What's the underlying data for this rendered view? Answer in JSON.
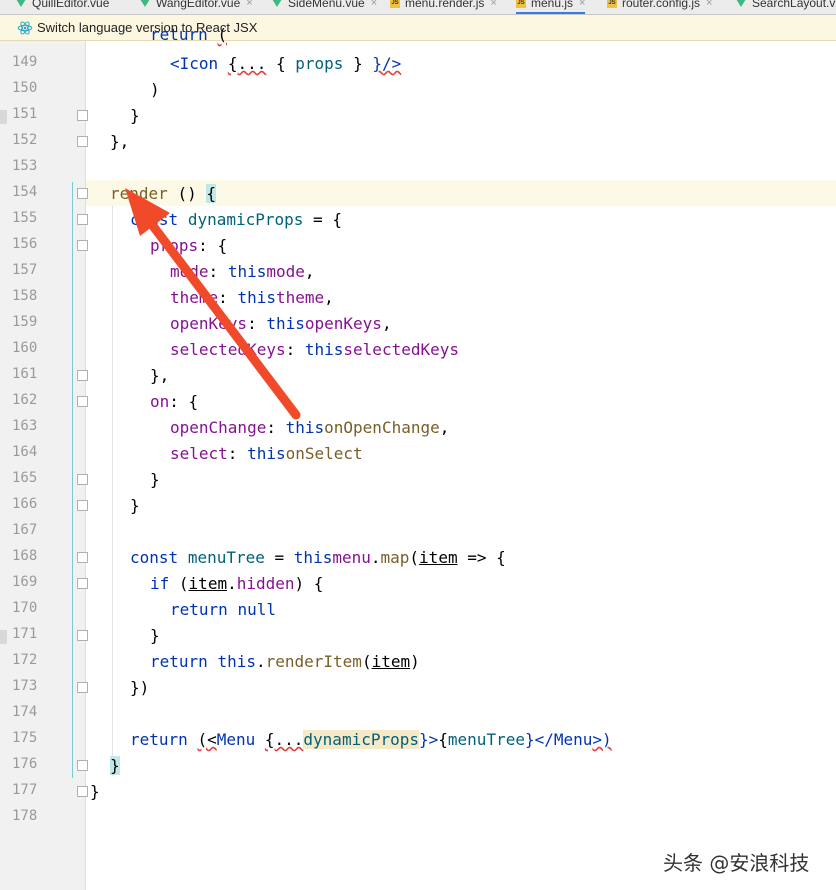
{
  "tabs": [
    {
      "label": "QuillEditor.vue",
      "type": "vue"
    },
    {
      "label": "WangEditor.vue",
      "type": "vue"
    },
    {
      "label": "SideMenu.vue",
      "type": "vue"
    },
    {
      "label": "menu.render.js",
      "type": "js"
    },
    {
      "label": "menu.js",
      "type": "js",
      "active": true
    },
    {
      "label": "router.config.js",
      "type": "js"
    },
    {
      "label": "SearchLayout.vue",
      "type": "vue"
    }
  ],
  "banner": {
    "text": "Switch language version to React JSX"
  },
  "line_numbers": [
    "149",
    "150",
    "151",
    "152",
    "153",
    "154",
    "155",
    "156",
    "157",
    "158",
    "159",
    "160",
    "161",
    "162",
    "163",
    "164",
    "165",
    "166",
    "167",
    "168",
    "169",
    "170",
    "171",
    "172",
    "173",
    "174",
    "175",
    "176",
    "177",
    "178"
  ],
  "code": {
    "l148": {
      "a": "return",
      "b": "(",
      "top_partial": true
    },
    "l149": {
      "a": "<Icon",
      "b": "{...",
      "c": "{",
      "d": "props",
      "e": "}",
      "f": "}/>"
    },
    "l150": {
      "a": ")"
    },
    "l151": {
      "a": "}"
    },
    "l152": {
      "a": "},"
    },
    "l154": {
      "a": "render",
      "b": "()",
      "c": "{"
    },
    "l155": {
      "a": "const",
      "b": "dynamicProps",
      "c": "= {"
    },
    "l156": {
      "a": "props",
      ":": ": {"
    },
    "l157": {
      "a": "mode",
      "b": ":",
      "c": "this",
      ".": ".",
      "d": "mode",
      ",": ","
    },
    "l158": {
      "a": "theme",
      "b": ":",
      "c": "this",
      ".": ".",
      "d": "theme",
      ",": ","
    },
    "l159": {
      "a": "openKeys",
      "b": ":",
      "c": "this",
      ".": ".",
      "d": "openKeys",
      ",": ","
    },
    "l160": {
      "a": "selectedKeys",
      "b": ":",
      "c": "this",
      ".": ".",
      "d": "selectedKeys"
    },
    "l161": {
      "a": "},"
    },
    "l162": {
      "a": "on",
      "b": ": {"
    },
    "l163": {
      "a": "openChange",
      "b": ":",
      "c": "this",
      ".": ".",
      "d": "onOpenChange",
      ",": ","
    },
    "l164": {
      "a": "select",
      "b": ":",
      "c": "this",
      ".": ".",
      "d": "onSelect"
    },
    "l165": {
      "a": "}"
    },
    "l166": {
      "a": "}"
    },
    "l168": {
      "a": "const",
      "b": "menuTree",
      "c": "=",
      "d": "this",
      ".": ".",
      "e": "menu",
      "f": ".",
      "g": "map",
      "h": "(",
      "i": "item",
      "j": "=> {"
    },
    "l169": {
      "a": "if",
      "b": "(",
      "c": "item",
      "d": ".",
      "e": "hidden",
      "f": ") {"
    },
    "l170": {
      "a": "return",
      "b": "null"
    },
    "l171": {
      "a": "}"
    },
    "l172": {
      "a": "return",
      "b": "this",
      "c": ".",
      "d": "renderItem",
      "e": "(",
      "f": "item",
      "g": ")"
    },
    "l173": {
      "a": "})"
    },
    "l175": {
      "a": "return",
      "b": "(<",
      "c": "Menu",
      "d": "{...",
      "e": "dynamicProps",
      "f": "}>",
      "g": "{",
      "h": "menuTree",
      "i": "}</",
      "j": "Menu",
      "k": ">)"
    },
    "l176": {
      "a": "}"
    },
    "l177": {
      "a": "}"
    }
  },
  "watermark": "头条 @安浪科技",
  "colors": {
    "keyword": "#0033b3",
    "property": "#871094",
    "function": "#00627a",
    "method": "#795e26",
    "arrow": "#f04a2a"
  }
}
